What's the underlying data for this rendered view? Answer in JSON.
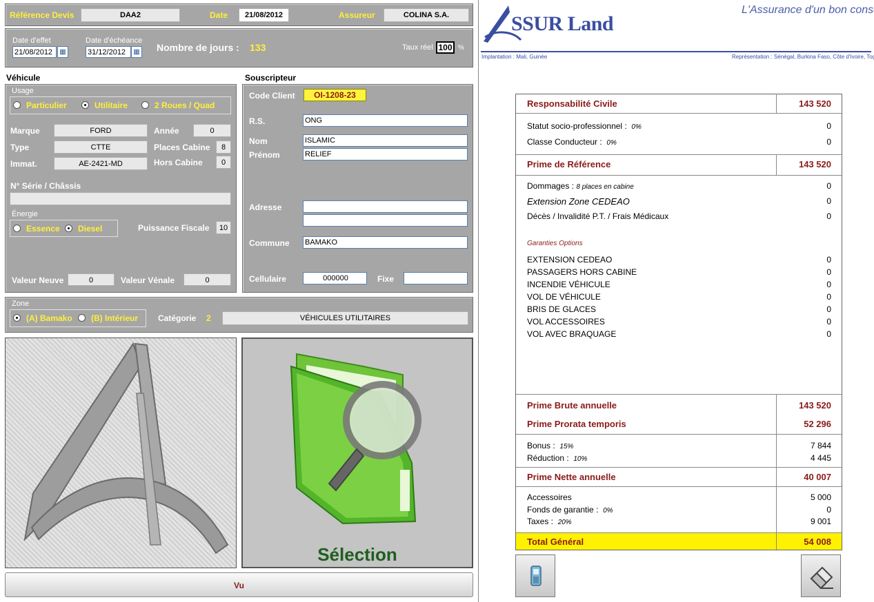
{
  "header": {
    "ref_label": "Référence Devis",
    "ref_value": "DAA2",
    "date_label": "Date",
    "date_value": "21/08/2012",
    "assureur_label": "Assureur",
    "assureur_value": "COLINA S.A.",
    "date_effet_label": "Date d'effet",
    "date_effet_value": "21/08/2012",
    "date_echeance_label": "Date d'échéance",
    "date_echeance_value": "31/12/2012",
    "jours_label": "Nombre de jours :",
    "jours_value": "133",
    "taux_label": "Taux réel",
    "taux_value": "100",
    "taux_unit": "%"
  },
  "vehicule": {
    "title": "Véhicule",
    "usage_label": "Usage",
    "usage_options": [
      "Particulier",
      "Utilitaire",
      "2 Roues / Quad"
    ],
    "usage_selected": "Utilitaire",
    "marque_label": "Marque",
    "marque_value": "FORD",
    "annee_label": "Année",
    "annee_value": "0",
    "type_label": "Type",
    "type_value": "CTTE",
    "places_label": "Places Cabine",
    "places_value": "8",
    "immat_label": "Immat.",
    "immat_value": "AE-2421-MD",
    "hors_label": "Hors Cabine",
    "hors_value": "0",
    "serie_label": "N° Série / Châssis",
    "serie_value": "",
    "energie_label": "Énergie",
    "energie_options": [
      "Essence",
      "Diesel"
    ],
    "energie_selected": "Diesel",
    "puissance_label": "Puissance Fiscale",
    "puissance_value": "10",
    "valeur_neuve_label": "Valeur Neuve",
    "valeur_neuve_value": "0",
    "valeur_venale_label": "Valeur Vénale",
    "valeur_venale_value": "0"
  },
  "souscripteur": {
    "title": "Souscripteur",
    "code_label": "Code Client",
    "code_value": "OI-1208-23",
    "rs_label": "R.S.",
    "rs_value": "ONG",
    "nom_label": "Nom",
    "nom_value": "ISLAMIC",
    "prenom_label": "Prénom",
    "prenom_value": "RELIEF",
    "adresse_label": "Adresse",
    "adresse1": "",
    "adresse2": "",
    "commune_label": "Commune",
    "commune_value": "BAMAKO",
    "cell_label": "Cellulaire",
    "cell_value": "000000",
    "fixe_label": "Fixe",
    "fixe_value": ""
  },
  "zone": {
    "label": "Zone",
    "options": [
      "(A) Bamako",
      "(B) Intérieur"
    ],
    "selected": "(A) Bamako",
    "categorie_label": "Catégorie",
    "categorie_num": "2",
    "categorie_value": "VÉHICULES UTILITAIRES"
  },
  "selection_label": "Sélection",
  "vu_button": "Vu",
  "brand": {
    "logo_text": "SSUR Land",
    "slogan": "L'Assurance d'un bon conseil",
    "implantation": "Implantation : Mali, Guinée",
    "representation": "Représentation : Sénégal, Burkina Faso, Côte d'Ivoire, Togo, Congo"
  },
  "summary": {
    "rc_label": "Responsabilité Civile",
    "rc_value": "143 520",
    "statut_label": "Statut socio-professionnel :",
    "statut_pct": "0%",
    "statut_value": "0",
    "classe_label": "Classe Conducteur :",
    "classe_pct": "0%",
    "classe_value": "0",
    "prime_ref_label": "Prime de Référence",
    "prime_ref_value": "143 520",
    "dommages_label": "Dommages :",
    "dommages_note": "8 places en cabine",
    "dommages_value": "0",
    "ext_label": "Extension Zone CEDEAO",
    "ext_value": "0",
    "deces_label": "Décès / Invalidité P.T. / Frais Médicaux",
    "deces_value": "0",
    "options_title": "Garanties Options",
    "options": [
      {
        "label": "EXTENSION CEDEAO",
        "value": "0"
      },
      {
        "label": "PASSAGERS HORS CABINE",
        "value": "0"
      },
      {
        "label": "INCENDIE VÉHICULE",
        "value": "0"
      },
      {
        "label": "VOL DE VÉHICULE",
        "value": "0"
      },
      {
        "label": "BRIS DE GLACES",
        "value": "0"
      },
      {
        "label": "VOL ACCESSOIRES",
        "value": "0"
      },
      {
        "label": "VOL AVEC BRAQUAGE",
        "value": "0"
      }
    ],
    "brute_label": "Prime Brute annuelle",
    "brute_value": "143 520",
    "prorata_label": "Prime Prorata temporis",
    "prorata_value": "52 296",
    "bonus_label": "Bonus :",
    "bonus_pct": "15%",
    "bonus_value": "7 844",
    "reduc_label": "Réduction :",
    "reduc_pct": "10%",
    "reduc_value": "4 445",
    "nette_label": "Prime Nette annuelle",
    "nette_value": "40 007",
    "acc_label": "Accessoires",
    "acc_value": "5 000",
    "fonds_label": "Fonds de garantie :",
    "fonds_pct": "0%",
    "fonds_value": "0",
    "taxes_label": "Taxes :",
    "taxes_pct": "20%",
    "taxes_value": "9 001",
    "total_label": "Total Général",
    "total_value": "54 008"
  },
  "icons": {
    "phone": "mobile-phone-icon",
    "eraser": "eraser-icon",
    "calendar": "calendar-icon",
    "folder": "folder-search-icon"
  }
}
